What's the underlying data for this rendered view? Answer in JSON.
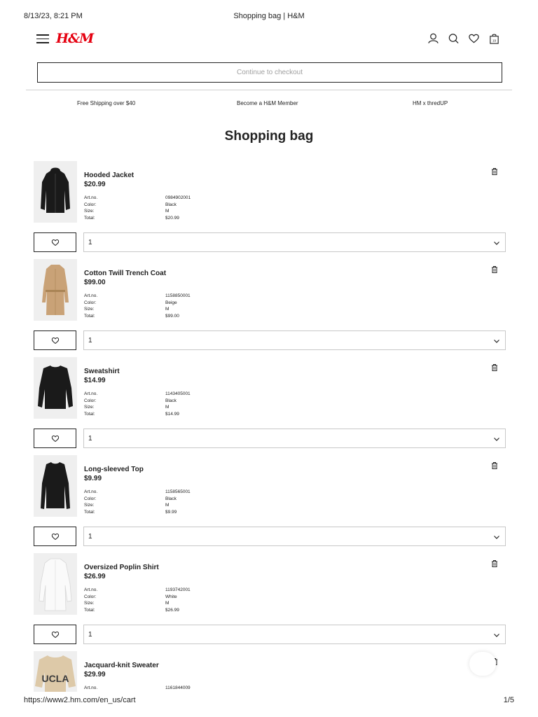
{
  "print": {
    "datetime": "8/13/23, 8:21 PM",
    "title": "Shopping bag | H&M",
    "url": "https://www2.hm.com/en_us/cart",
    "page": "1/5"
  },
  "header": {
    "logo": "H&M",
    "icons": [
      "menu-icon",
      "account-icon",
      "search-icon",
      "favorites-icon",
      "bag-icon"
    ],
    "bag_count": "19"
  },
  "checkout": {
    "label": "Continue to checkout"
  },
  "promos": [
    "Free Shipping over $40",
    "Become a H&M Member",
    "HM x thredUP"
  ],
  "page_title": "Shopping bag",
  "labels": {
    "art": "Art.no.",
    "color": "Color:",
    "size": "Size:",
    "total": "Total:"
  },
  "items": [
    {
      "name": "Hooded Jacket",
      "price": "$20.99",
      "art": "0984902001",
      "color": "Black",
      "size": "M",
      "total": "$20.99",
      "qty": "1"
    },
    {
      "name": "Cotton Twill Trench Coat",
      "price": "$99.00",
      "art": "1158850001",
      "color": "Beige",
      "size": "M",
      "total": "$99.00",
      "qty": "1"
    },
    {
      "name": "Sweatshirt",
      "price": "$14.99",
      "art": "1143405001",
      "color": "Black",
      "size": "M",
      "total": "$14.99",
      "qty": "1"
    },
    {
      "name": "Long-sleeved Top",
      "price": "$9.99",
      "art": "1158565001",
      "color": "Black",
      "size": "M",
      "total": "$9.99",
      "qty": "1"
    },
    {
      "name": "Oversized Poplin Shirt",
      "price": "$26.99",
      "art": "1193742001",
      "color": "White",
      "size": "M",
      "total": "$26.99",
      "qty": "1"
    },
    {
      "name": "Jacquard-knit Sweater",
      "price": "$29.99",
      "art": "1161844009"
    }
  ],
  "sweater_print": "UCLA",
  "colors": {
    "brand": "#e50010",
    "text": "#222222",
    "muted": "#a0a0a0",
    "border": "#c8c8c8"
  }
}
